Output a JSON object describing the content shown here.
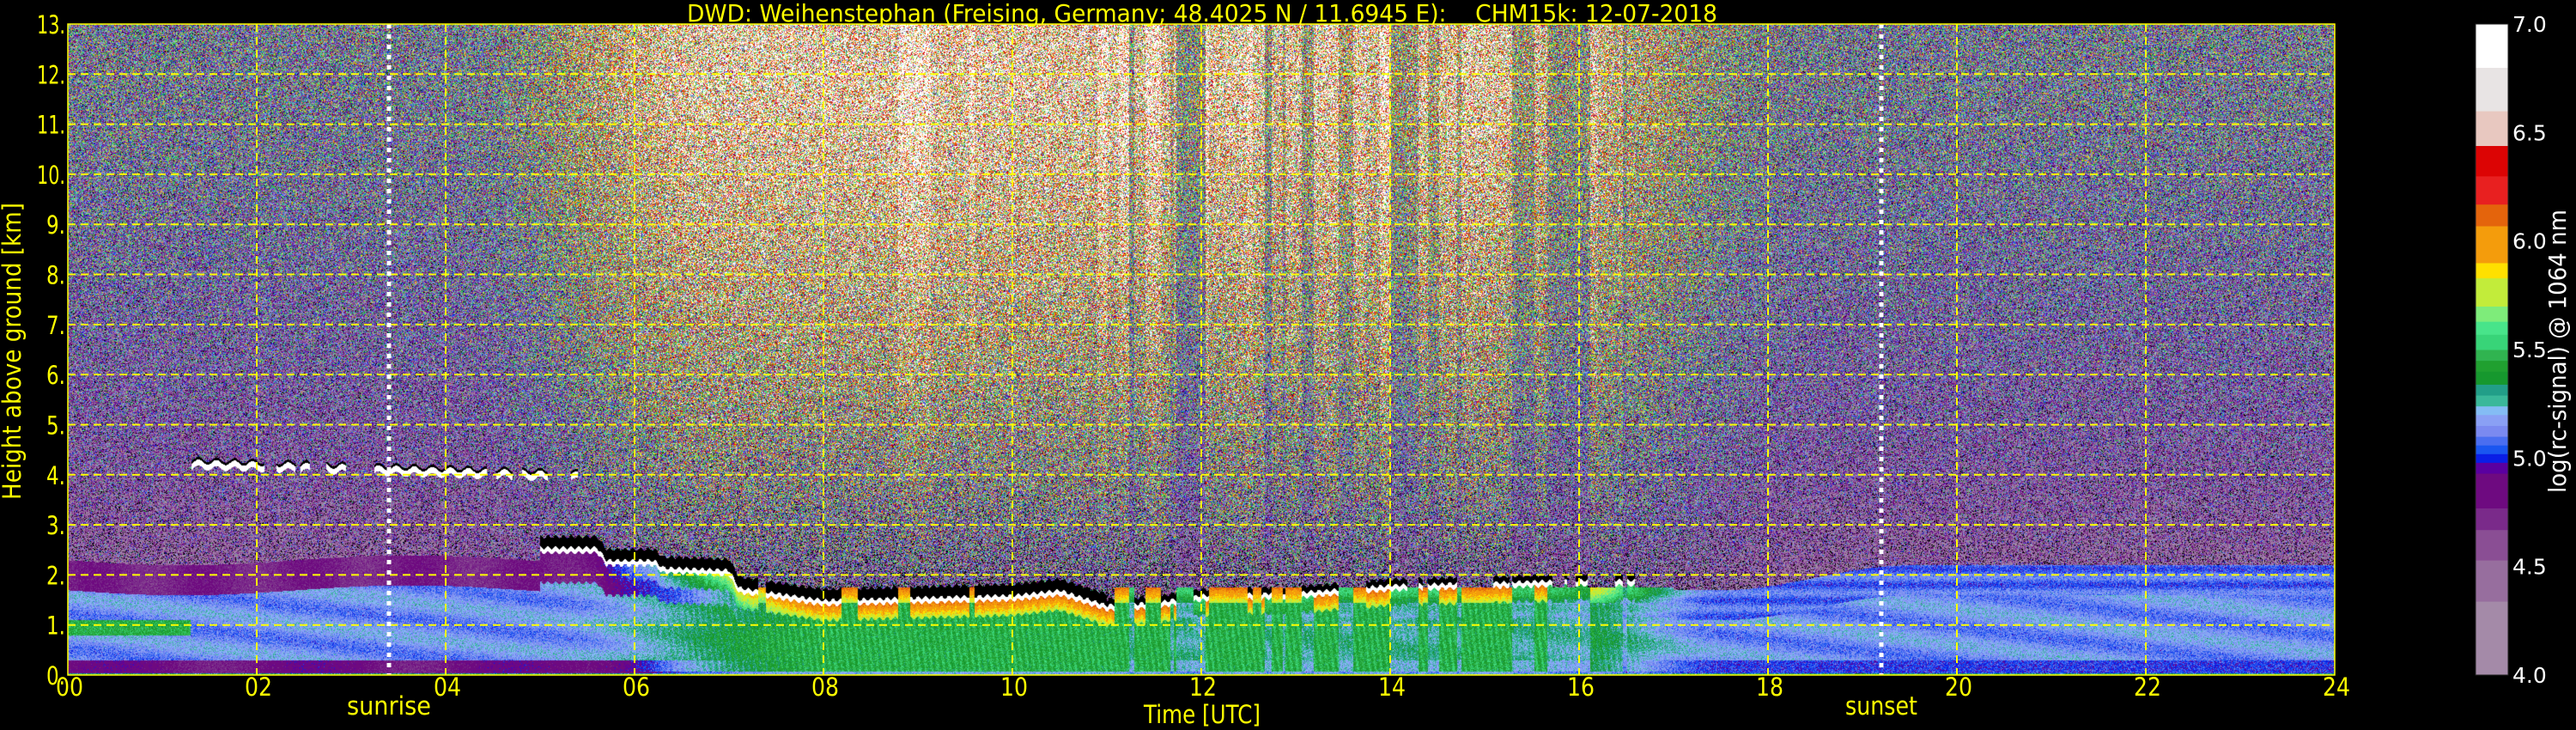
{
  "chart_data": {
    "type": "heatmap",
    "title": "DWD: Weihenstephan (Freising, Germany; 48.4025 N / 11.6945 E):    CHM15k: 12-07-2018",
    "xlabel": "Time [UTC]",
    "ylabel": "Height above ground [km]",
    "xlim": [
      0,
      24
    ],
    "ylim": [
      0,
      13
    ],
    "x_ticks": [
      0,
      2,
      4,
      6,
      8,
      10,
      12,
      14,
      16,
      18,
      20,
      22,
      24
    ],
    "x_tick_labels": [
      "00",
      "02",
      "04",
      "06",
      "08",
      "10",
      "12",
      "14",
      "16",
      "18",
      "20",
      "22",
      "24"
    ],
    "y_ticks": [
      0,
      1,
      2,
      3,
      4,
      5,
      6,
      7,
      8,
      9,
      10,
      11,
      12,
      13
    ],
    "y_tick_labels": [
      "0.",
      "1.",
      "2.",
      "3.",
      "4.",
      "5.",
      "6.",
      "7.",
      "8.",
      "9.",
      "10.",
      "11.",
      "12.",
      "13."
    ],
    "grid": true,
    "colorbar": {
      "label": "log(rc-signal) @ 1064 nm",
      "range": [
        4.0,
        7.0
      ],
      "ticks": [
        4.0,
        4.5,
        5.0,
        5.5,
        6.0,
        6.5,
        7.0
      ],
      "tick_labels": [
        "4.0",
        "4.5",
        "5.0",
        "5.5",
        "6.0",
        "6.5",
        "7.0"
      ],
      "bounds": [
        4.0,
        4.34,
        4.53,
        4.67,
        4.77,
        4.93,
        4.98,
        5.02,
        5.06,
        5.1,
        5.15,
        5.2,
        5.24,
        5.29,
        5.34,
        5.4,
        5.45,
        5.5,
        5.57,
        5.63,
        5.7,
        5.83,
        5.9,
        6.07,
        6.17,
        6.3,
        6.44,
        6.6,
        6.8,
        7.0
      ],
      "colors": [
        "#a48aa8",
        "#976e9e",
        "#8a4e94",
        "#7a2a8a",
        "#6e0a80",
        "#5a00a0",
        "#0a1ee6",
        "#1a56f0",
        "#4a6ef0",
        "#7b8af0",
        "#8aa0f4",
        "#84bcf4",
        "#3ab89a",
        "#229e88",
        "#16982e",
        "#20a030",
        "#30b450",
        "#38d478",
        "#48e48a",
        "#7eec7a",
        "#c2ec3a",
        "#ffe000",
        "#f49c0c",
        "#e4640c",
        "#e82020",
        "#dc0404",
        "#e8c8c0",
        "#e8e4e4",
        "#ffffff"
      ]
    },
    "annotations": [
      {
        "label": "sunrise",
        "time": 3.4
      },
      {
        "label": "sunset",
        "time": 19.2
      }
    ],
    "features": {
      "elevated_cloud_layer": {
        "time_range": [
          1.3,
          5.4
        ],
        "height_km": [
          3.9,
          4.3
        ]
      },
      "boundary_layer_cloud_base": [
        [
          5.0,
          2.45
        ],
        [
          5.6,
          2.45
        ],
        [
          5.7,
          2.2
        ],
        [
          6.2,
          2.2
        ],
        [
          6.3,
          2.05
        ],
        [
          7.0,
          2.0
        ],
        [
          7.1,
          1.65
        ],
        [
          8,
          1.4
        ],
        [
          9,
          1.45
        ],
        [
          10,
          1.5
        ],
        [
          10.5,
          1.6
        ],
        [
          11,
          1.3
        ],
        [
          11.5,
          1.35
        ],
        [
          12,
          1.5
        ],
        [
          13,
          1.55
        ],
        [
          14,
          1.7
        ],
        [
          15,
          1.75
        ],
        [
          16,
          1.8
        ],
        [
          16.6,
          1.8
        ]
      ]
    },
    "grid_color": "#ffff00",
    "axis_text_color": "#ffff00"
  }
}
